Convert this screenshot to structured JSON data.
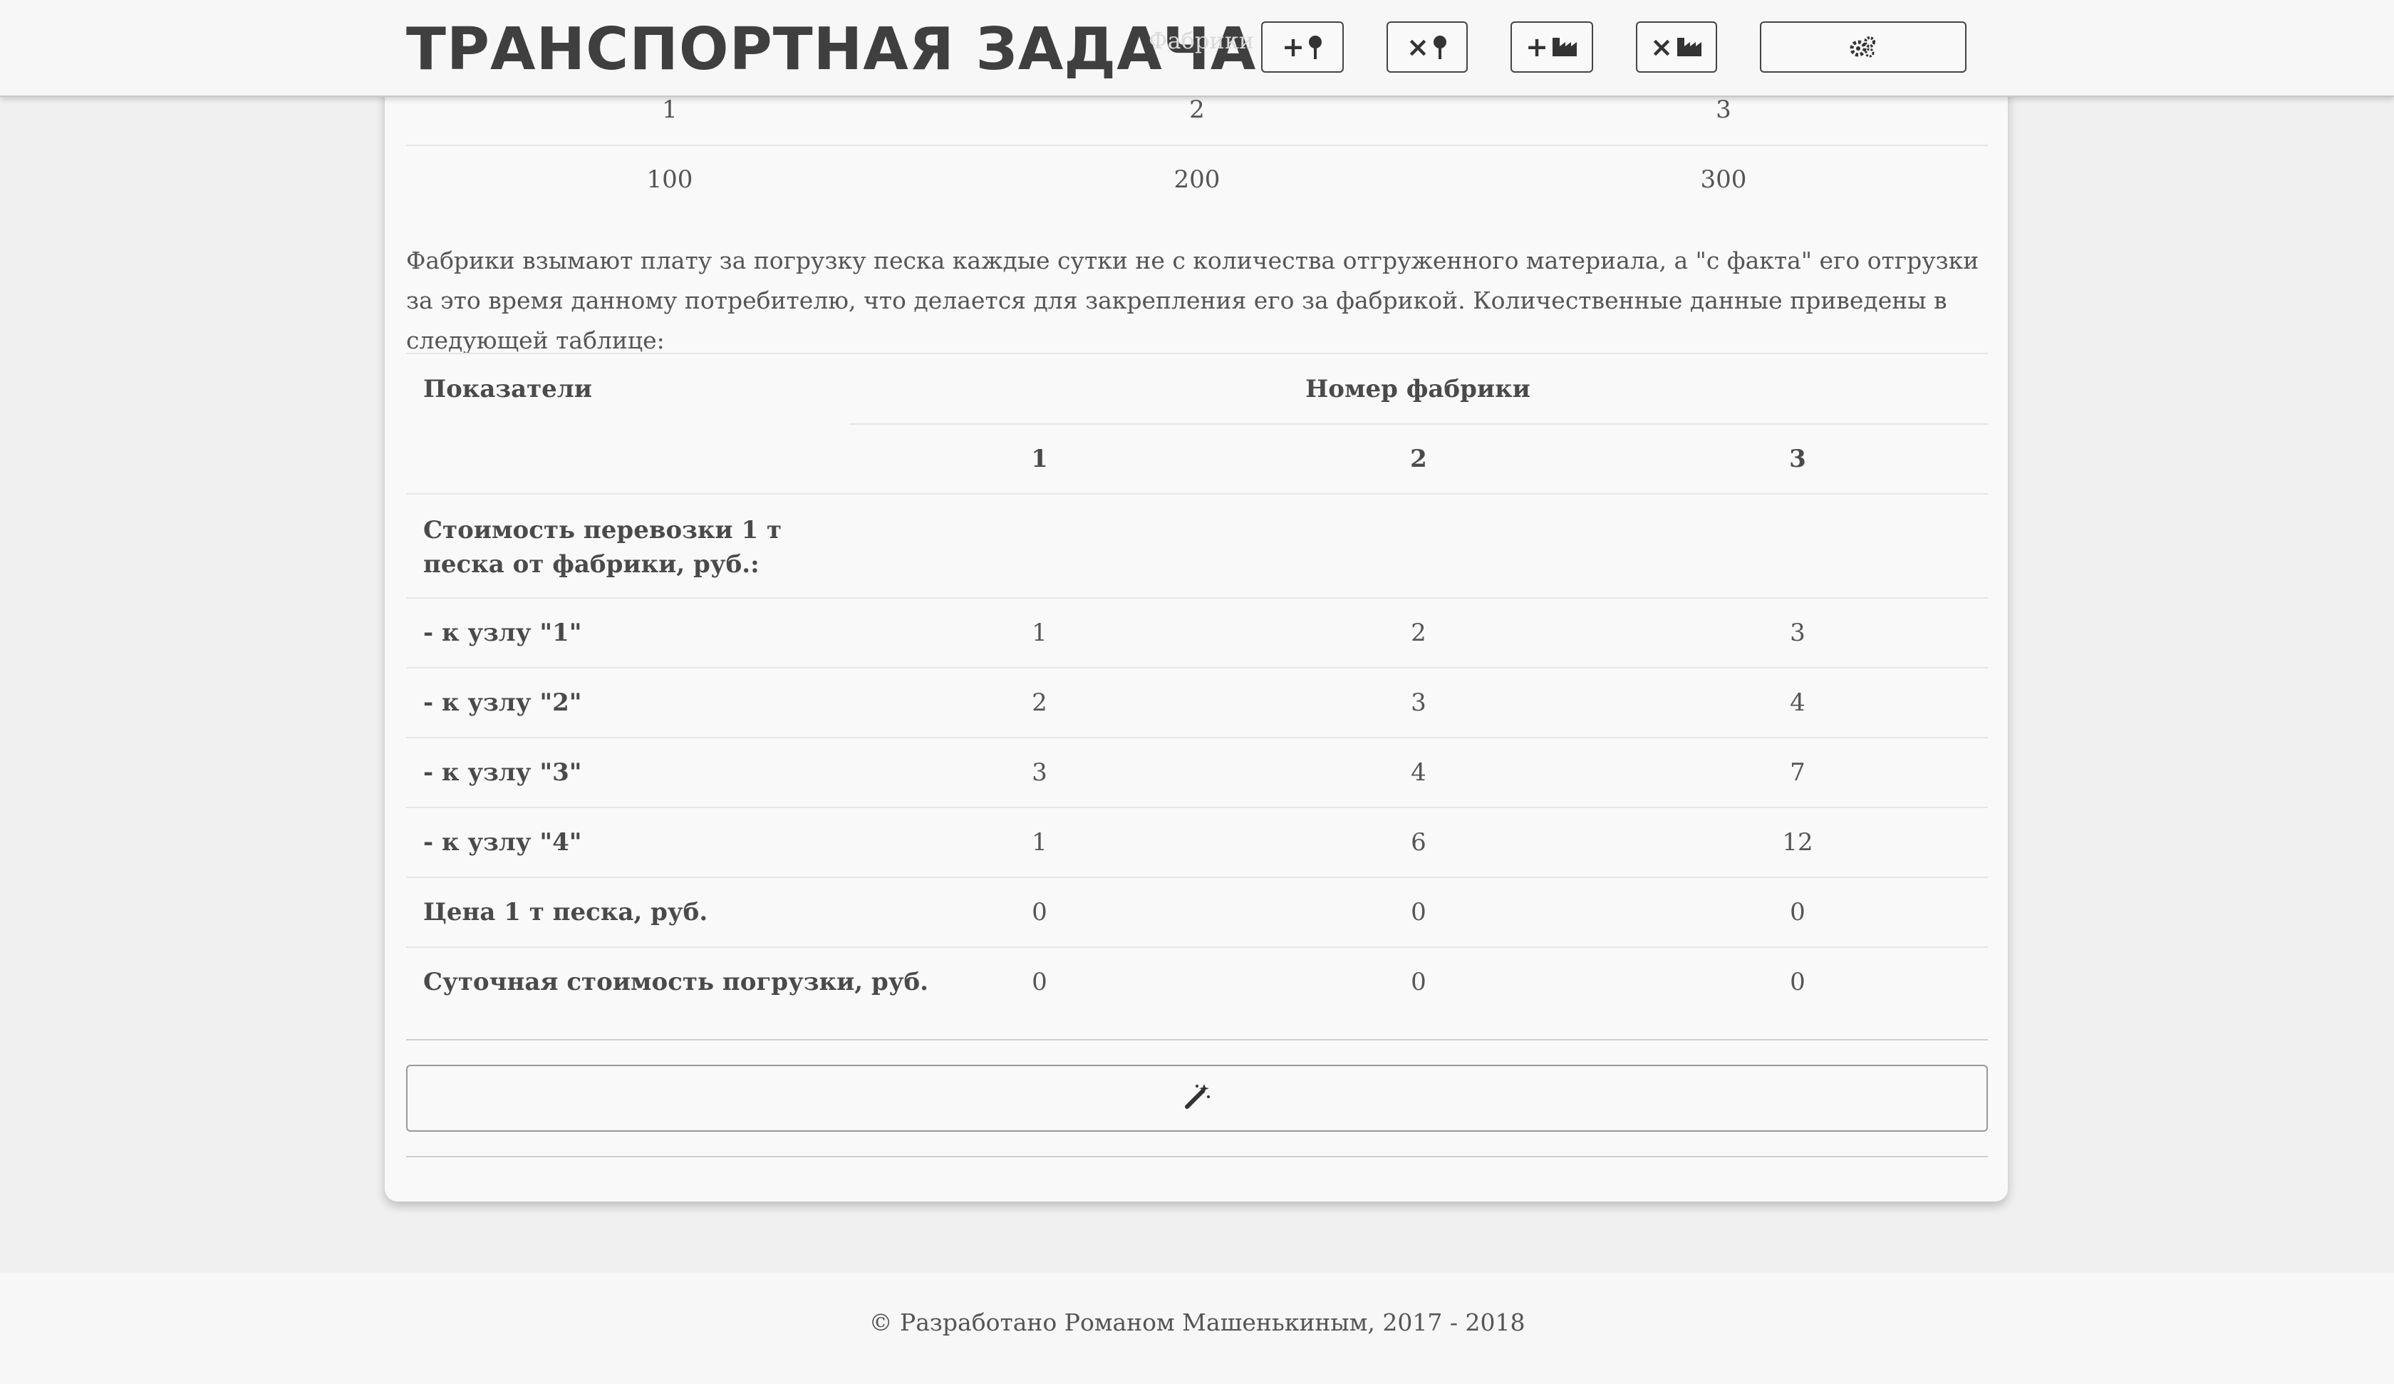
{
  "header": {
    "title": "ТРАНСПОРТНАЯ ЗАДАЧА",
    "faded_label": "Фабрики",
    "buttons": [
      {
        "icon": "plus-pin-icon"
      },
      {
        "icon": "times-pin-icon"
      },
      {
        "icon": "plus-factory-icon"
      },
      {
        "icon": "times-factory-icon"
      },
      {
        "icon": "cogs-icon"
      }
    ]
  },
  "factories_table": {
    "numbers": [
      "1",
      "2",
      "3"
    ],
    "values": [
      "100",
      "200",
      "300"
    ]
  },
  "paragraph": "Фабрики взымают плату за погрузку песка каждые сутки не с количества отгруженного материала, а \"с факта\" его отгрузки за это время данному потребителю, что делается для закрепления его за фабрикой. Количественные данные приведены в следующей таблице:",
  "data_table": {
    "header_indicators": "Показатели",
    "header_factory_number": "Номер фабрики",
    "factory_columns": [
      "1",
      "2",
      "3"
    ],
    "section_label": "Стоимость перевозки 1 т песка от фабрики, руб.:",
    "rows": [
      {
        "label": "- к узлу \"1\"",
        "values": [
          "1",
          "2",
          "3"
        ]
      },
      {
        "label": "- к узлу \"2\"",
        "values": [
          "2",
          "3",
          "4"
        ]
      },
      {
        "label": "- к узлу \"3\"",
        "values": [
          "3",
          "4",
          "7"
        ]
      },
      {
        "label": "- к узлу \"4\"",
        "values": [
          "1",
          "6",
          "12"
        ]
      },
      {
        "label": "Цена 1 т песка, руб.",
        "values": [
          "0",
          "0",
          "0"
        ]
      },
      {
        "label": "Суточная стоимость погрузки, руб.",
        "values": [
          "0",
          "0",
          "0"
        ]
      }
    ]
  },
  "solve_button": {
    "icon": "magic-wand-icon"
  },
  "footer": {
    "text": "© Разработано Романом Машенькиным, 2017 - 2018"
  }
}
